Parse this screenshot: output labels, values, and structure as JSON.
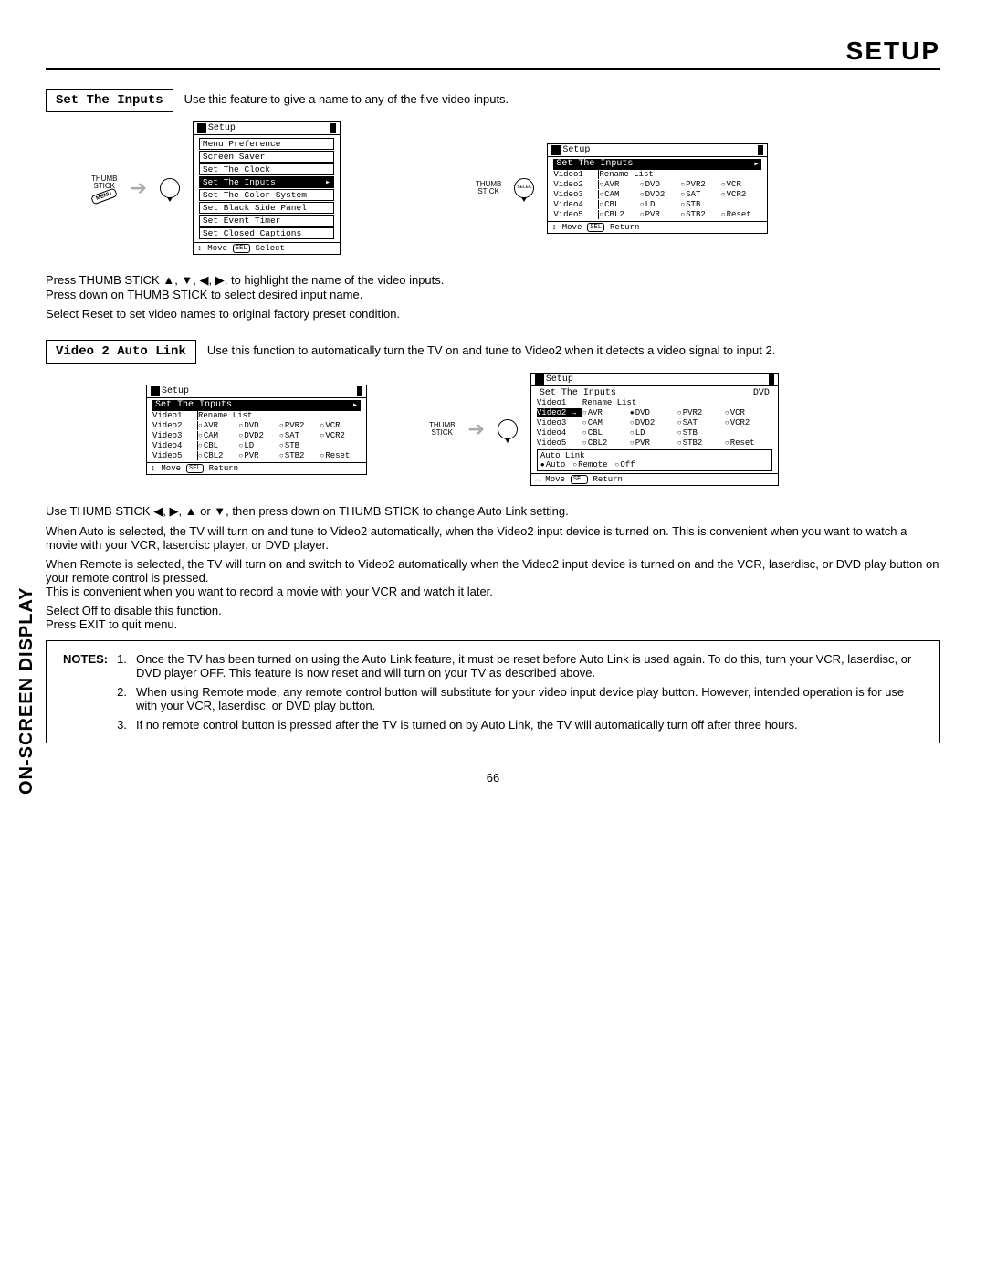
{
  "header": "SETUP",
  "side_label": "ON-SCREEN DISPLAY",
  "page_num": "66",
  "s1": {
    "title": "Set The Inputs",
    "desc": "Use this feature to give a name to any of the five video inputs.",
    "thumb": "THUMB\nSTICK",
    "menu_btn": "MENU",
    "osd_a_title": "Setup",
    "osd_a_items": [
      "Menu Preference",
      "Screen Saver",
      "Set The Clock",
      "Set The Inputs",
      "Set The Color System",
      "Set Black Side Panel",
      "Set Event Timer",
      "Set Closed Captions"
    ],
    "osd_a_hl": 3,
    "osd_a_foot_move": "Move",
    "osd_a_foot_sel": "Select",
    "osd_a_foot_key": "SEL",
    "osd_b_title": "Setup",
    "osd_b_sub": "Set The Inputs",
    "rename": "Rename List",
    "rows": [
      "Video1",
      "Video2",
      "Video3",
      "Video4",
      "Video5"
    ],
    "opts": [
      [
        "AVR",
        "DVD",
        "PVR2",
        "VCR"
      ],
      [
        "CAM",
        "DVD2",
        "SAT",
        "VCR2"
      ],
      [
        "CBL",
        "LD",
        "STB",
        ""
      ],
      [
        "CBL2",
        "PVR",
        "STB2",
        "Reset"
      ]
    ],
    "foot_return": "Return",
    "p1": "Press THUMB STICK ▲, ▼, ◀, ▶, to highlight the name of the video inputs.",
    "p2": "Press down on THUMB STICK to select desired input name.",
    "p3": "Select Reset to set video names to original factory preset condition."
  },
  "s2": {
    "title": "Video 2 Auto Link",
    "desc": "Use this function to automatically turn the TV on and tune to Video2 when it detects a video signal to input 2.",
    "osd_d_sel_label": "DVD",
    "autolink_label": "Auto Link",
    "autolink_opts": [
      "Auto",
      "Remote",
      "Off"
    ],
    "autolink_sel": 0,
    "p1": "Use THUMB STICK ◀, ▶, ▲ or ▼, then press down on THUMB STICK to change Auto Link setting.",
    "p2": "When Auto is selected, the TV will turn on and tune to Video2 automatically, when the Video2 input device is turned on. This is convenient when you want to watch a movie with your VCR, laserdisc player, or DVD player.",
    "p3": "When Remote is selected, the TV will turn on and switch to Video2 automatically when the Video2 input device is turned on and the VCR, laserdisc, or DVD play button on your remote control is pressed.",
    "p4": "This is convenient when you want to record a movie with your VCR and watch it later.",
    "p5": "Select Off to disable this function.",
    "p6": "Press EXIT to quit menu."
  },
  "notes": {
    "label": "NOTES:",
    "n1": "Once the TV has been turned on using the Auto Link feature, it must be reset before Auto Link is used again. To do this, turn your VCR, laserdisc, or DVD player OFF. This feature is now reset and will turn on your TV as described above.",
    "n2": "When using Remote mode, any remote control button will substitute for your video input device play button. However, intended operation is for use with your VCR, laserdisc, or DVD play button.",
    "n3": "If no remote control button is pressed after the TV is turned on by Auto Link, the TV will automatically turn off after three hours."
  }
}
